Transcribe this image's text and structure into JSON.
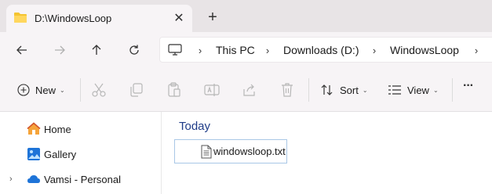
{
  "tab": {
    "title": "D:\\WindowsLoop",
    "close_glyph": "✕",
    "new_tab_glyph": "+"
  },
  "nav_buttons": {
    "back_icon": "arrow-left-icon",
    "forward_icon": "arrow-right-icon",
    "up_icon": "arrow-up-icon",
    "refresh_icon": "refresh-icon"
  },
  "breadcrumb": {
    "root_icon": "computer-icon",
    "separator": "›",
    "items": [
      "This PC",
      "Downloads (D:)",
      "WindowsLoop"
    ]
  },
  "command_bar": {
    "new_label": "New",
    "sort_label": "Sort",
    "view_label": "View",
    "more_glyph": "···",
    "chevron_glyph": "⌄"
  },
  "nav_pane": {
    "expander_glyph": "›",
    "items": [
      {
        "label": "Home",
        "icon": "home-icon"
      },
      {
        "label": "Gallery",
        "icon": "gallery-icon"
      },
      {
        "label": "Vamsi - Personal",
        "icon": "cloud-icon"
      }
    ]
  },
  "content": {
    "group_header": "Today",
    "files": [
      {
        "name": "windowsloop.txt",
        "icon": "text-file-icon"
      }
    ]
  },
  "colors": {
    "folder": "#f4c430",
    "header_blue": "#1f3c88",
    "selection_border": "#a9c7e6",
    "onedrive": "#1e74d8"
  }
}
